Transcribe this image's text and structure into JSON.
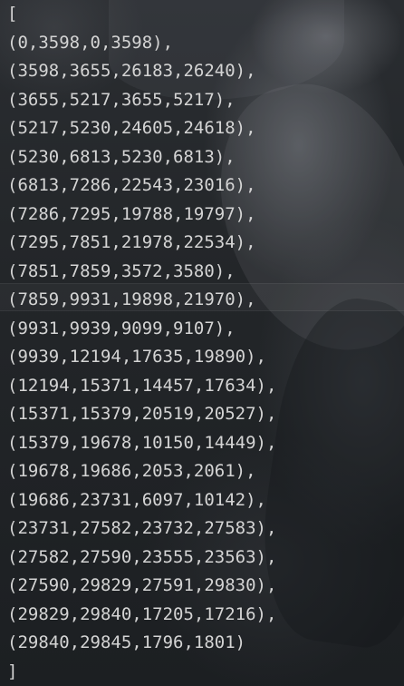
{
  "editor": {
    "open_bracket": "[",
    "close_bracket": "]",
    "lines": [
      "(0,3598,0,3598),",
      "(3598,3655,26183,26240),",
      "(3655,5217,3655,5217),",
      "(5217,5230,24605,24618),",
      "(5230,6813,5230,6813),",
      "(6813,7286,22543,23016),",
      "(7286,7295,19788,19797),",
      "(7295,7851,21978,22534),",
      "(7851,7859,3572,3580),",
      "(7859,9931,19898,21970),",
      "(9931,9939,9099,9107),",
      "(9939,12194,17635,19890),",
      "(12194,15371,14457,17634),",
      "(15371,15379,20519,20527),",
      "(15379,19678,10150,14449),",
      "(19678,19686,2053,2061),",
      "(19686,23731,6097,10142),",
      "(23731,27582,23732,27583),",
      "(27582,27590,23555,23563),",
      "(27590,29829,27591,29830),",
      "(29829,29840,17205,17216),",
      "(29840,29845,1796,1801)"
    ]
  },
  "colors": {
    "text": "#d4d4d4",
    "background": "#1d2024"
  }
}
